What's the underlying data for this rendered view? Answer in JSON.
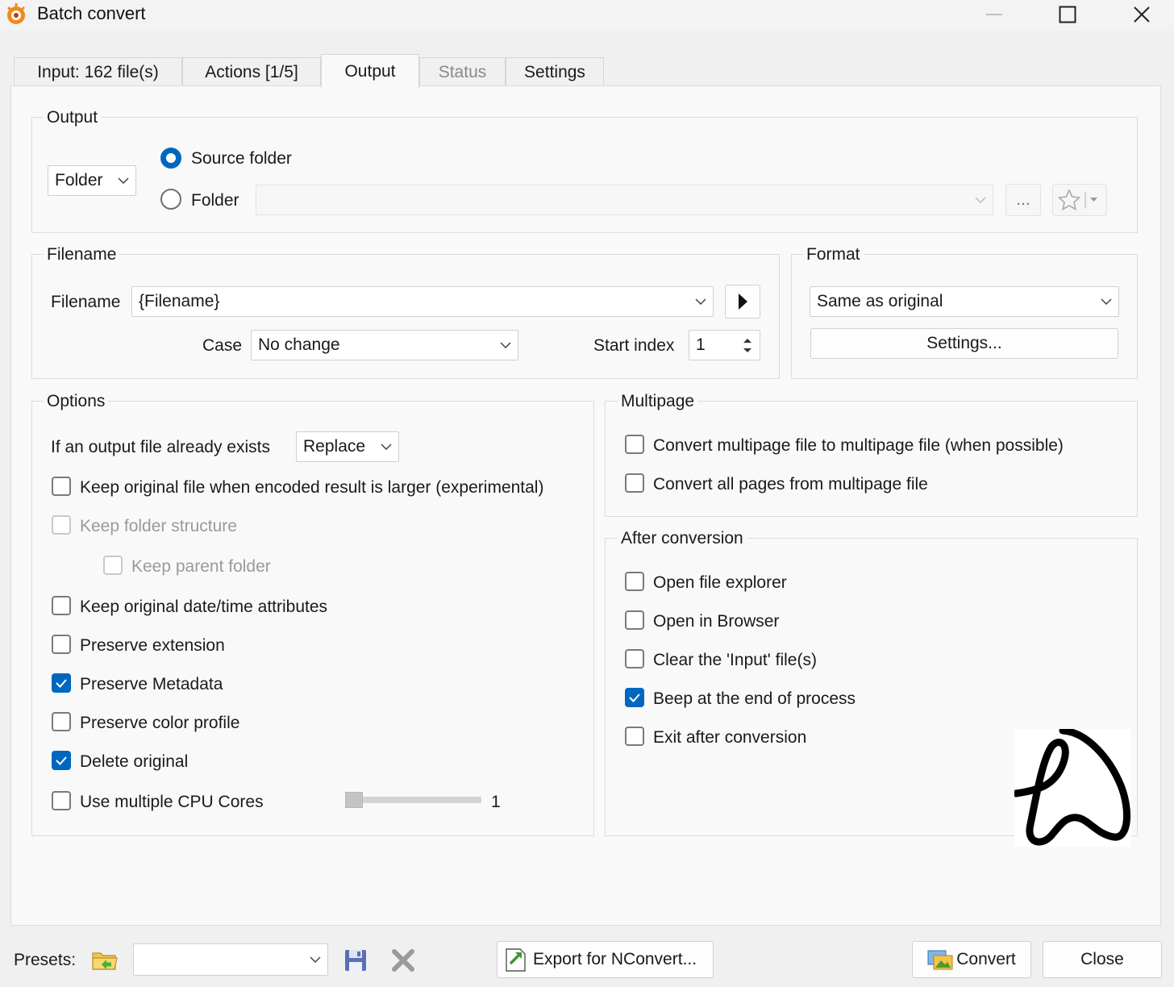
{
  "window": {
    "title": "Batch convert",
    "app_icon": "xnview-logo-icon",
    "controls": [
      "minimize-icon",
      "maximize-icon",
      "close-icon"
    ]
  },
  "tabs": [
    {
      "label": "Input: 162 file(s)",
      "state": "normal"
    },
    {
      "label": "Actions [1/5]",
      "state": "normal"
    },
    {
      "label": "Output",
      "state": "active"
    },
    {
      "label": "Status",
      "state": "disabled"
    },
    {
      "label": "Settings",
      "state": "normal"
    }
  ],
  "output": {
    "group_label": "Output",
    "type_select": "Folder",
    "radio_source": {
      "label": "Source folder",
      "selected": true
    },
    "radio_folder": {
      "label": "Folder",
      "selected": false
    },
    "folder_path": "",
    "browse_label": "...",
    "favorite_icon": "star-icon"
  },
  "filename": {
    "group_label": "Filename",
    "filename_label": "Filename",
    "filename_value": "{Filename}",
    "case_label": "Case",
    "case_value": "No change",
    "start_index_label": "Start index",
    "start_index_value": "1"
  },
  "format": {
    "group_label": "Format",
    "format_value": "Same as original",
    "settings_label": "Settings..."
  },
  "options": {
    "group_label": "Options",
    "exists_label": "If an output file already exists",
    "exists_value": "Replace",
    "items": [
      {
        "label": "Keep original file when encoded result is larger (experimental)",
        "checked": false,
        "enabled": true
      },
      {
        "label": "Keep folder structure",
        "checked": false,
        "enabled": false
      },
      {
        "label": "Keep parent folder",
        "checked": false,
        "enabled": false
      },
      {
        "label": "Keep original date/time attributes",
        "checked": false,
        "enabled": true
      },
      {
        "label": "Preserve extension",
        "checked": false,
        "enabled": true
      },
      {
        "label": "Preserve Metadata",
        "checked": true,
        "enabled": true
      },
      {
        "label": "Preserve color profile",
        "checked": false,
        "enabled": true
      },
      {
        "label": "Delete original",
        "checked": true,
        "enabled": true
      },
      {
        "label": "Use multiple CPU Cores",
        "checked": false,
        "enabled": true
      }
    ],
    "cpu_cores_value": "1",
    "cpu_cores_fraction": 0.0
  },
  "multipage": {
    "group_label": "Multipage",
    "items": [
      {
        "label": "Convert multipage file to multipage file (when possible)",
        "checked": false
      },
      {
        "label": "Convert all pages from multipage file",
        "checked": false
      }
    ]
  },
  "after": {
    "group_label": "After conversion",
    "items": [
      {
        "label": "Open file explorer",
        "checked": false
      },
      {
        "label": "Open in Browser",
        "checked": false
      },
      {
        "label": "Clear the 'Input' file(s)",
        "checked": false
      },
      {
        "label": "Beep at the end of process",
        "checked": true
      },
      {
        "label": "Exit after conversion",
        "checked": false
      }
    ]
  },
  "bottom": {
    "presets_label": "Presets:",
    "presets_value": "",
    "export_label": "Export for NConvert...",
    "convert_label": "Convert",
    "close_label": "Close"
  },
  "colors": {
    "accent": "#0067c0",
    "background": "#f0f0f0",
    "panel": "#f9f9f9"
  }
}
